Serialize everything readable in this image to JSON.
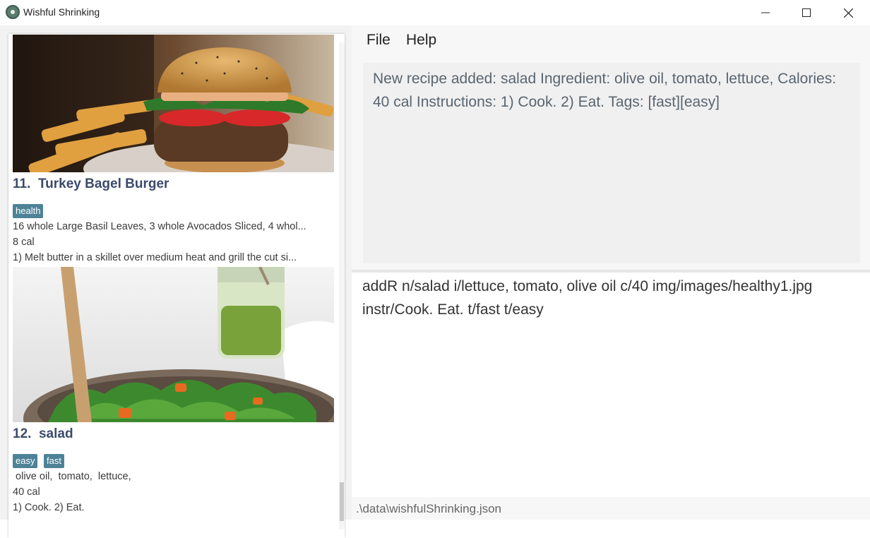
{
  "window": {
    "title": "Wishful Shrinking",
    "icon": "app-logo-icon",
    "controls": [
      "minimize-icon",
      "maximize-icon",
      "close-icon"
    ]
  },
  "recipes": [
    {
      "index": "11.",
      "name": "Turkey Bagel Burger",
      "tags": [
        "health"
      ],
      "ingredients": "16 whole Large Basil Leaves, 3 whole Avocados Sliced, 4 whol...",
      "calories": "8 cal",
      "instructions": "1) Melt butter in a skillet over medium heat and grill the cut si..."
    },
    {
      "index": "12.",
      "name": "salad",
      "tags": [
        "easy",
        "fast"
      ],
      "ingredients": " olive oil,  tomato,  lettuce,",
      "calories": "40 cal",
      "instructions": "1) Cook. 2) Eat."
    }
  ],
  "menu": {
    "file": "File",
    "help": "Help"
  },
  "result": {
    "text": "New recipe added: salad Ingredient:  olive oil,  tomato,  lettuce,  Calories: 40 cal Instructions: 1) Cook.  2) Eat. Tags: [fast][easy]"
  },
  "command": {
    "value": "addR n/salad i/lettuce, tomato, olive oil c/40 img/images/healthy1.jpg instr/Cook. Eat. t/fast t/easy"
  },
  "status": {
    "path": ".\\data\\wishfulShrinking.json"
  },
  "colors": {
    "tag": "#4d8297",
    "title": "#3c4a6b"
  }
}
